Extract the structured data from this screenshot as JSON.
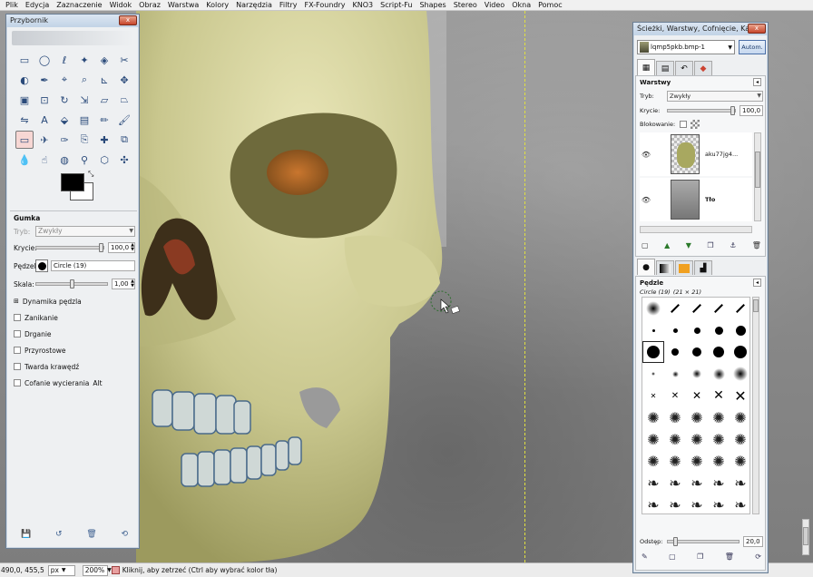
{
  "menubar": {
    "items": [
      "Plik",
      "Edycja",
      "Zaznaczenie",
      "Widok",
      "Obraz",
      "Warstwa",
      "Kolory",
      "Narzędzia",
      "Filtry",
      "FX-Foundry",
      "KNO3",
      "Script-Fu",
      "Shapes",
      "Stereo",
      "Video",
      "Okna",
      "Pomoc"
    ]
  },
  "toolbox": {
    "title": "Przybornik",
    "close": "x",
    "tools": [
      "rect-select",
      "ellipse-select",
      "free-select",
      "fuzzy-select",
      "by-color-select",
      "scissors-select",
      "foreground-select",
      "paths",
      "color-picker",
      "zoom",
      "measure",
      "move",
      "align",
      "crop",
      "rotate",
      "scale",
      "shear",
      "perspective",
      "flip",
      "text",
      "bucket-fill",
      "blend",
      "pencil",
      "paintbrush",
      "eraser",
      "airbrush",
      "ink",
      "clone",
      "heal",
      "perspective-clone",
      "blur",
      "smudge",
      "dodge-burn",
      "smudge-finger",
      "cage",
      "magnify"
    ],
    "active_tool": 24,
    "options": {
      "title": "Gumka",
      "mode_label": "Tryb:",
      "mode_value": "Zwykły",
      "opacity_label": "Krycie:",
      "opacity_value": "100,0",
      "brush_label": "Pędzel:",
      "brush_value": "Circle (19)",
      "scale_label": "Skala:",
      "scale_value": "1,00",
      "dynamics_label": "Dynamika pędzla",
      "checks": [
        "Zanikanie",
        "Drganie",
        "Przyrostowe",
        "Twarda krawędź"
      ],
      "undo_label": "Cofanie wycierania",
      "undo_key": "Alt"
    }
  },
  "dock": {
    "title": "Ścieżki, Warstwy, Cofnięcie, Kana...",
    "close": "x",
    "image_name": "lqmp5pkb.bmp-1",
    "auto_button": "Autom.",
    "layers_title": "Warstwy",
    "mode_label": "Tryb:",
    "mode_value": "Zwykły",
    "opacity_label": "Krycie:",
    "opacity_value": "100,0",
    "lock_label": "Blokowanie:",
    "layers": [
      {
        "name": "aku77jg4..."
      },
      {
        "name": "Tło"
      }
    ],
    "brushes_title": "Pędzle",
    "brush_selected": "Circle (19)",
    "brush_size": "(21 × 21)",
    "spacing_label": "Odstęp:",
    "spacing_value": "20,0"
  },
  "statusbar": {
    "coords": "490,0, 455,5",
    "unit": "px",
    "zoom": "200%",
    "message": "Kliknij, aby zetrzeć (Ctrl aby wybrać kolor tła)"
  },
  "colors": {
    "foreground": "#000000",
    "background": "#ffffff",
    "skull": "#d8d8a0",
    "canvas_bg": "#8a8a8a"
  }
}
